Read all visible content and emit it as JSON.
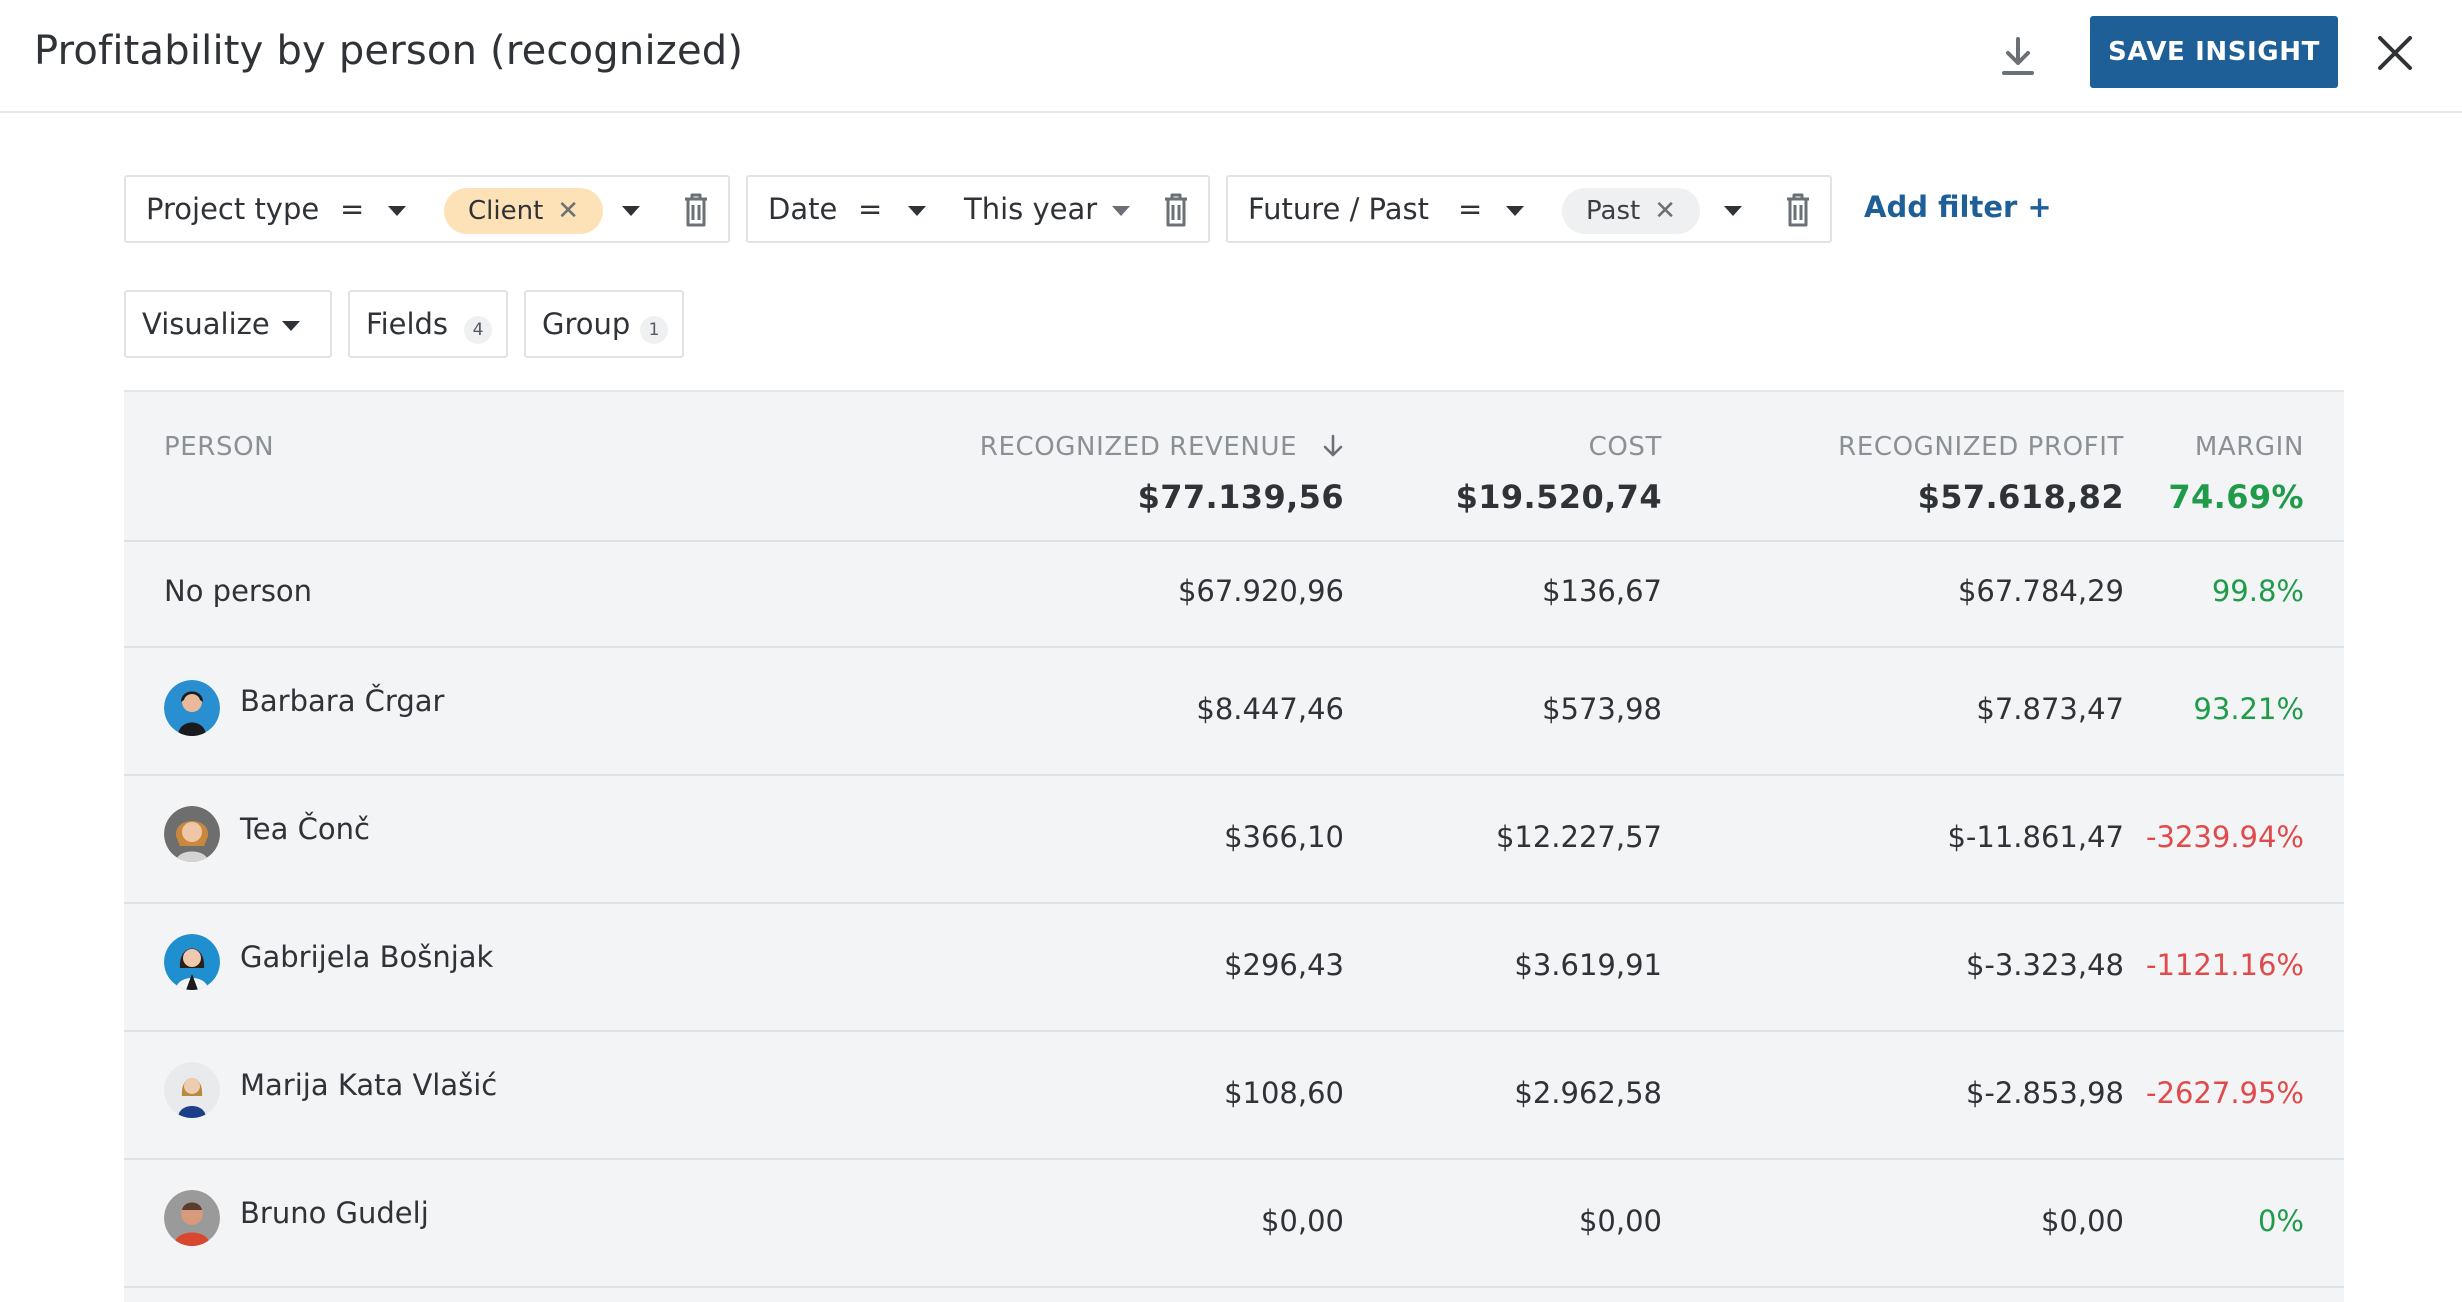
{
  "header": {
    "title": "Profitability by person (recognized)",
    "save_label": "SAVE INSIGHT"
  },
  "filters": [
    {
      "field": "Project type",
      "operator": "=",
      "value": "Client"
    },
    {
      "field": "Date",
      "operator": "=",
      "value": "This year"
    },
    {
      "field": "Future / Past",
      "operator": "=",
      "value": "Past"
    }
  ],
  "add_filter_label": "Add filter +",
  "controls": {
    "visualize_label": "Visualize",
    "fields_label": "Fields",
    "fields_count": "4",
    "group_label": "Group",
    "group_count": "1"
  },
  "table": {
    "columns": [
      "PERSON",
      "RECOGNIZED REVENUE",
      "COST",
      "RECOGNIZED PROFIT",
      "MARGIN"
    ],
    "totals": {
      "revenue": "$77.139,56",
      "cost": "$19.520,74",
      "profit": "$57.618,82",
      "margin": "74.69%"
    },
    "rows": [
      {
        "person": "No person",
        "revenue": "$67.920,96",
        "cost": "$136,67",
        "profit": "$67.784,29",
        "margin": "99.8%"
      },
      {
        "person": "Barbara Črgar",
        "revenue": "$8.447,46",
        "cost": "$573,98",
        "profit": "$7.873,47",
        "margin": "93.21%"
      },
      {
        "person": "Tea Čonč",
        "revenue": "$366,10",
        "cost": "$12.227,57",
        "profit": "$-11.861,47",
        "margin": "-3239.94%"
      },
      {
        "person": "Gabrijela Bošnjak",
        "revenue": "$296,43",
        "cost": "$3.619,91",
        "profit": "$-3.323,48",
        "margin": "-1121.16%"
      },
      {
        "person": "Marija Kata Vlašić",
        "revenue": "$108,60",
        "cost": "$2.962,58",
        "profit": "$-2.853,98",
        "margin": "-2627.95%"
      },
      {
        "person": "Bruno Gudelj",
        "revenue": "$0,00",
        "cost": "$0,00",
        "profit": "$0,00",
        "margin": "0%"
      }
    ]
  },
  "colors": {
    "accent": "#1f5f98",
    "positive": "#1f9b4a",
    "negative": "#e04a4a",
    "chip_client": "#fde2b8",
    "chip_past": "#eef0f2"
  },
  "icons": {
    "download": "download-icon",
    "close": "close-icon",
    "caret": "caret-down-icon",
    "trash": "trash-icon",
    "sort": "arrow-down-icon",
    "chip_remove": "x-icon"
  }
}
